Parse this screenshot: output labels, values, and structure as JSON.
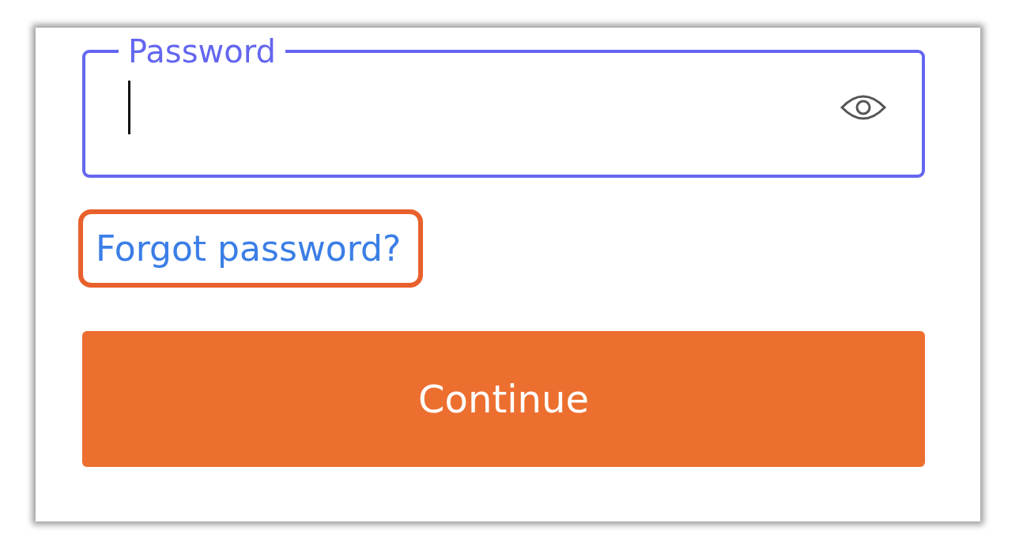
{
  "password_field": {
    "label": "Password",
    "focused": true
  },
  "forgot_link": {
    "label": "Forgot password?",
    "highlighted": true
  },
  "continue_button": {
    "label": "Continue"
  }
}
